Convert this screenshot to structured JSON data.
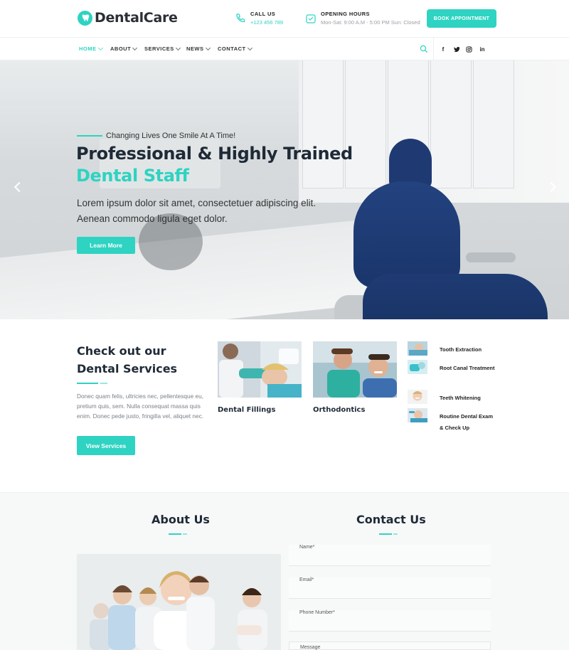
{
  "brand": {
    "name": "DentalCare",
    "accent": "#2ed3c2"
  },
  "header": {
    "call": {
      "title": "CALL US",
      "value": "+123 456 789",
      "icon": "phone-icon"
    },
    "hours": {
      "title": "OPENING HOURS",
      "value": "Mon-Sat: 9:00 A.M - 5:00 PM Sun: Closed",
      "icon": "clock-icon"
    },
    "book_label": "BOOK APPOINTMENT"
  },
  "nav": {
    "items": [
      {
        "label": "HOME",
        "active": true
      },
      {
        "label": "ABOUT",
        "active": false
      },
      {
        "label": "SERVICES",
        "active": false
      },
      {
        "label": "NEWS",
        "active": false
      },
      {
        "label": "CONTACT",
        "active": false
      }
    ],
    "social": [
      "f",
      "t",
      "ig",
      "in"
    ]
  },
  "hero": {
    "tagline": "Changing Lives One Smile At A Time!",
    "title_line1": "Professional & Highly Trained",
    "title_line2": "Dental Staff",
    "paragraph": "Lorem ipsum dolor sit amet, consectetuer adipiscing elit. Aenean commodo ligula eget dolor.",
    "cta": "Learn More"
  },
  "services": {
    "title": "Check out our Dental Services",
    "description": "Donec quam felis, ultricies nec, pellentesque eu, pretium quis, sem. Nulla consequat massa quis enim. Donec pede justo, fringilla vel, aliquet nec.",
    "cta": "View Services",
    "cards": [
      {
        "label": "Dental Fillings"
      },
      {
        "label": "Orthodontics"
      }
    ],
    "list": [
      {
        "label": "Tooth Extraction"
      },
      {
        "label": "Root Canal Treatment"
      },
      {
        "label": "Teeth Whitening"
      },
      {
        "label": "Routine Dental Exam & Check Up"
      }
    ]
  },
  "about": {
    "title": "About Us"
  },
  "contact": {
    "title": "Contact Us",
    "fields": [
      "Name*",
      "Email*",
      "Phone Number*",
      "Message"
    ]
  }
}
